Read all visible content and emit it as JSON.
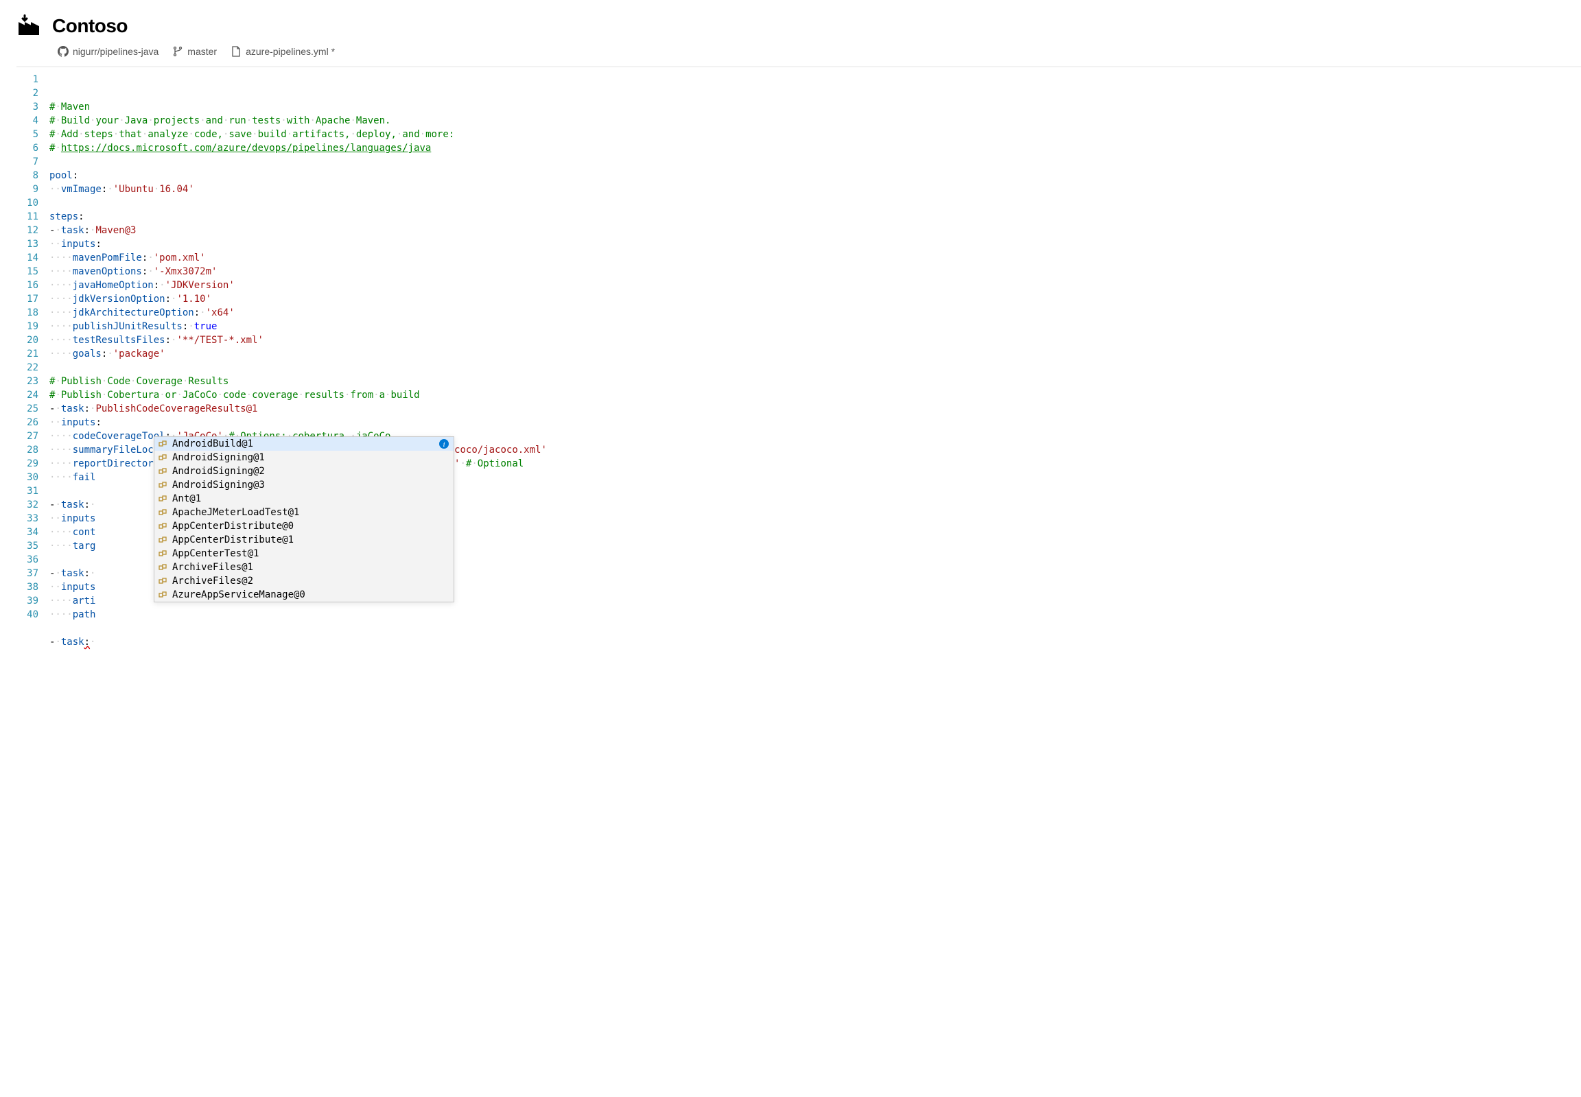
{
  "header": {
    "title": "Contoso"
  },
  "breadcrumb": {
    "repo": "nigurr/pipelines-java",
    "branch": "master",
    "file": "azure-pipelines.yml *"
  },
  "code": {
    "lines": [
      {
        "num": 1,
        "tokens": [
          {
            "t": "# ",
            "c": "comment"
          },
          {
            "t": "·",
            "c": "dot"
          },
          {
            "t": "Maven",
            "c": "comment"
          }
        ]
      },
      {
        "num": 2,
        "tokens": [
          {
            "t": "# ",
            "c": "comment"
          },
          {
            "t": "·",
            "c": "dot"
          },
          {
            "t": "Build",
            "c": "comment"
          },
          {
            "t": "·",
            "c": "dot"
          },
          {
            "t": "your",
            "c": "comment"
          },
          {
            "t": "·",
            "c": "dot"
          },
          {
            "t": "Java",
            "c": "comment"
          },
          {
            "t": "·",
            "c": "dot"
          },
          {
            "t": "projects",
            "c": "comment"
          },
          {
            "t": "·",
            "c": "dot"
          },
          {
            "t": "and",
            "c": "comment"
          },
          {
            "t": "·",
            "c": "dot"
          },
          {
            "t": "run",
            "c": "comment"
          },
          {
            "t": "·",
            "c": "dot"
          },
          {
            "t": "tests",
            "c": "comment"
          },
          {
            "t": "·",
            "c": "dot"
          },
          {
            "t": "with",
            "c": "comment"
          },
          {
            "t": "·",
            "c": "dot"
          },
          {
            "t": "Apache",
            "c": "comment"
          },
          {
            "t": "·",
            "c": "dot"
          },
          {
            "t": "Maven.",
            "c": "comment"
          }
        ]
      },
      {
        "num": 3,
        "tokens": [
          {
            "t": "# ",
            "c": "comment"
          },
          {
            "t": "·",
            "c": "dot"
          },
          {
            "t": "Add",
            "c": "comment"
          },
          {
            "t": "·",
            "c": "dot"
          },
          {
            "t": "steps",
            "c": "comment"
          },
          {
            "t": "·",
            "c": "dot"
          },
          {
            "t": "that",
            "c": "comment"
          },
          {
            "t": "·",
            "c": "dot"
          },
          {
            "t": "analyze",
            "c": "comment"
          },
          {
            "t": "·",
            "c": "dot"
          },
          {
            "t": "code,",
            "c": "comment"
          },
          {
            "t": "·",
            "c": "dot"
          },
          {
            "t": "save",
            "c": "comment"
          },
          {
            "t": "·",
            "c": "dot"
          },
          {
            "t": "build",
            "c": "comment"
          },
          {
            "t": "·",
            "c": "dot"
          },
          {
            "t": "artifacts,",
            "c": "comment"
          },
          {
            "t": "·",
            "c": "dot"
          },
          {
            "t": "deploy,",
            "c": "comment"
          },
          {
            "t": "·",
            "c": "dot"
          },
          {
            "t": "and",
            "c": "comment"
          },
          {
            "t": "·",
            "c": "dot"
          },
          {
            "t": "more:",
            "c": "comment"
          }
        ]
      },
      {
        "num": 4,
        "tokens": [
          {
            "t": "# ",
            "c": "comment"
          },
          {
            "t": "·",
            "c": "dot"
          },
          {
            "t": "https://docs.microsoft.com/azure/devops/pipelines/languages/java",
            "c": "comment underline"
          }
        ]
      },
      {
        "num": 5,
        "tokens": []
      },
      {
        "num": 6,
        "tokens": [
          {
            "t": "pool",
            "c": "key"
          },
          {
            "t": ":",
            "c": "punct"
          }
        ]
      },
      {
        "num": 7,
        "tokens": [
          {
            "t": "··",
            "c": "dot"
          },
          {
            "t": "vmImage",
            "c": "key"
          },
          {
            "t": ":",
            "c": "punct"
          },
          {
            "t": "·",
            "c": "dot"
          },
          {
            "t": "'Ubuntu",
            "c": "string"
          },
          {
            "t": "·",
            "c": "dot"
          },
          {
            "t": "16.04'",
            "c": "string"
          }
        ]
      },
      {
        "num": 8,
        "tokens": []
      },
      {
        "num": 9,
        "tokens": [
          {
            "t": "steps",
            "c": "key"
          },
          {
            "t": ":",
            "c": "punct"
          }
        ]
      },
      {
        "num": 10,
        "tokens": [
          {
            "t": "-",
            "c": "punct"
          },
          {
            "t": "·",
            "c": "dot"
          },
          {
            "t": "task",
            "c": "key"
          },
          {
            "t": ":",
            "c": "punct"
          },
          {
            "t": "·",
            "c": "dot"
          },
          {
            "t": "Maven@3",
            "c": "string"
          }
        ]
      },
      {
        "num": 11,
        "tokens": [
          {
            "t": "··",
            "c": "dot"
          },
          {
            "t": "inputs",
            "c": "key"
          },
          {
            "t": ":",
            "c": "punct"
          }
        ]
      },
      {
        "num": 12,
        "tokens": [
          {
            "t": "····",
            "c": "dot"
          },
          {
            "t": "mavenPomFile",
            "c": "key"
          },
          {
            "t": ":",
            "c": "punct"
          },
          {
            "t": "·",
            "c": "dot"
          },
          {
            "t": "'pom.xml'",
            "c": "string"
          }
        ]
      },
      {
        "num": 13,
        "tokens": [
          {
            "t": "····",
            "c": "dot"
          },
          {
            "t": "mavenOptions",
            "c": "key"
          },
          {
            "t": ":",
            "c": "punct"
          },
          {
            "t": "·",
            "c": "dot"
          },
          {
            "t": "'-Xmx3072m'",
            "c": "string"
          }
        ]
      },
      {
        "num": 14,
        "tokens": [
          {
            "t": "····",
            "c": "dot"
          },
          {
            "t": "javaHomeOption",
            "c": "key"
          },
          {
            "t": ":",
            "c": "punct"
          },
          {
            "t": "·",
            "c": "dot"
          },
          {
            "t": "'JDKVersion'",
            "c": "string"
          }
        ]
      },
      {
        "num": 15,
        "tokens": [
          {
            "t": "····",
            "c": "dot"
          },
          {
            "t": "jdkVersionOption",
            "c": "key"
          },
          {
            "t": ":",
            "c": "punct"
          },
          {
            "t": "·",
            "c": "dot"
          },
          {
            "t": "'1.10'",
            "c": "string"
          }
        ]
      },
      {
        "num": 16,
        "tokens": [
          {
            "t": "····",
            "c": "dot"
          },
          {
            "t": "jdkArchitectureOption",
            "c": "key"
          },
          {
            "t": ":",
            "c": "punct"
          },
          {
            "t": "·",
            "c": "dot"
          },
          {
            "t": "'x64'",
            "c": "string"
          }
        ]
      },
      {
        "num": 17,
        "tokens": [
          {
            "t": "····",
            "c": "dot"
          },
          {
            "t": "publishJUnitResults",
            "c": "key"
          },
          {
            "t": ":",
            "c": "punct"
          },
          {
            "t": "·",
            "c": "dot"
          },
          {
            "t": "true",
            "c": "bool"
          }
        ]
      },
      {
        "num": 18,
        "tokens": [
          {
            "t": "····",
            "c": "dot"
          },
          {
            "t": "testResultsFiles",
            "c": "key"
          },
          {
            "t": ":",
            "c": "punct"
          },
          {
            "t": "·",
            "c": "dot"
          },
          {
            "t": "'**/TEST-*.xml'",
            "c": "string"
          }
        ]
      },
      {
        "num": 19,
        "tokens": [
          {
            "t": "····",
            "c": "dot"
          },
          {
            "t": "goals",
            "c": "key"
          },
          {
            "t": ":",
            "c": "punct"
          },
          {
            "t": "·",
            "c": "dot"
          },
          {
            "t": "'package'",
            "c": "string"
          }
        ]
      },
      {
        "num": 20,
        "tokens": []
      },
      {
        "num": 21,
        "tokens": [
          {
            "t": "# ",
            "c": "comment"
          },
          {
            "t": "·",
            "c": "dot"
          },
          {
            "t": "Publish",
            "c": "comment"
          },
          {
            "t": "·",
            "c": "dot"
          },
          {
            "t": "Code",
            "c": "comment"
          },
          {
            "t": "·",
            "c": "dot"
          },
          {
            "t": "Coverage",
            "c": "comment"
          },
          {
            "t": "·",
            "c": "dot"
          },
          {
            "t": "Results",
            "c": "comment"
          }
        ]
      },
      {
        "num": 22,
        "tokens": [
          {
            "t": "# ",
            "c": "comment"
          },
          {
            "t": "·",
            "c": "dot"
          },
          {
            "t": "Publish",
            "c": "comment"
          },
          {
            "t": "·",
            "c": "dot"
          },
          {
            "t": "Cobertura",
            "c": "comment"
          },
          {
            "t": "·",
            "c": "dot"
          },
          {
            "t": "or",
            "c": "comment"
          },
          {
            "t": "·",
            "c": "dot"
          },
          {
            "t": "JaCoCo",
            "c": "comment"
          },
          {
            "t": "·",
            "c": "dot"
          },
          {
            "t": "code",
            "c": "comment"
          },
          {
            "t": "·",
            "c": "dot"
          },
          {
            "t": "coverage",
            "c": "comment"
          },
          {
            "t": "·",
            "c": "dot"
          },
          {
            "t": "results",
            "c": "comment"
          },
          {
            "t": "·",
            "c": "dot"
          },
          {
            "t": "from",
            "c": "comment"
          },
          {
            "t": "·",
            "c": "dot"
          },
          {
            "t": "a",
            "c": "comment"
          },
          {
            "t": "·",
            "c": "dot"
          },
          {
            "t": "build",
            "c": "comment"
          }
        ]
      },
      {
        "num": 23,
        "tokens": [
          {
            "t": "-",
            "c": "punct"
          },
          {
            "t": "·",
            "c": "dot"
          },
          {
            "t": "task",
            "c": "key"
          },
          {
            "t": ":",
            "c": "punct"
          },
          {
            "t": "·",
            "c": "dot"
          },
          {
            "t": "PublishCodeCoverageResults@1",
            "c": "string"
          }
        ]
      },
      {
        "num": 24,
        "tokens": [
          {
            "t": "··",
            "c": "dot"
          },
          {
            "t": "inputs",
            "c": "key"
          },
          {
            "t": ":",
            "c": "punct"
          }
        ]
      },
      {
        "num": 25,
        "tokens": [
          {
            "t": "····",
            "c": "dot"
          },
          {
            "t": "codeCoverageTool",
            "c": "key"
          },
          {
            "t": ":",
            "c": "punct"
          },
          {
            "t": "·",
            "c": "dot"
          },
          {
            "t": "'JaCoCo'",
            "c": "string"
          },
          {
            "t": "·",
            "c": "dot"
          },
          {
            "t": "# ",
            "c": "comment"
          },
          {
            "t": "·",
            "c": "dot"
          },
          {
            "t": "Options:",
            "c": "comment"
          },
          {
            "t": "·",
            "c": "dot"
          },
          {
            "t": "cobertura,",
            "c": "comment"
          },
          {
            "t": "·",
            "c": "dot"
          },
          {
            "t": "jaCoCo",
            "c": "comment"
          }
        ]
      },
      {
        "num": 26,
        "tokens": [
          {
            "t": "····",
            "c": "dot"
          },
          {
            "t": "summaryFileLocation",
            "c": "key"
          },
          {
            "t": ":",
            "c": "punct"
          },
          {
            "t": "·",
            "c": "dot"
          },
          {
            "t": "'$(System.DefaultWorkingDirectory)/**/site/jacoco/jacoco.xml'",
            "c": "string"
          }
        ]
      },
      {
        "num": 27,
        "tokens": [
          {
            "t": "····",
            "c": "dot"
          },
          {
            "t": "reportDirectory",
            "c": "key"
          },
          {
            "t": ":",
            "c": "punct"
          },
          {
            "t": "·",
            "c": "dot"
          },
          {
            "t": "'$(System.DefaultWorkingDirectory)/**/site/jacoco'",
            "c": "string"
          },
          {
            "t": "·",
            "c": "dot"
          },
          {
            "t": "# ",
            "c": "comment"
          },
          {
            "t": "·",
            "c": "dot"
          },
          {
            "t": "Optional",
            "c": "comment"
          }
        ]
      },
      {
        "num": 28,
        "tokens": [
          {
            "t": "····",
            "c": "dot"
          },
          {
            "t": "fail",
            "c": "key"
          }
        ]
      },
      {
        "num": 29,
        "tokens": []
      },
      {
        "num": 30,
        "tokens": [
          {
            "t": "-",
            "c": "punct"
          },
          {
            "t": "·",
            "c": "dot"
          },
          {
            "t": "task",
            "c": "key"
          },
          {
            "t": ":",
            "c": "punct"
          },
          {
            "t": "·",
            "c": "dot"
          }
        ]
      },
      {
        "num": 31,
        "tokens": [
          {
            "t": "··",
            "c": "dot"
          },
          {
            "t": "inputs",
            "c": "key"
          }
        ]
      },
      {
        "num": 32,
        "tokens": [
          {
            "t": "····",
            "c": "dot"
          },
          {
            "t": "cont",
            "c": "key"
          }
        ]
      },
      {
        "num": 33,
        "tokens": [
          {
            "t": "····",
            "c": "dot"
          },
          {
            "t": "targ",
            "c": "key"
          }
        ]
      },
      {
        "num": 34,
        "tokens": []
      },
      {
        "num": 35,
        "tokens": [
          {
            "t": "-",
            "c": "punct"
          },
          {
            "t": "·",
            "c": "dot"
          },
          {
            "t": "task",
            "c": "key"
          },
          {
            "t": ":",
            "c": "punct"
          },
          {
            "t": "·",
            "c": "dot"
          }
        ]
      },
      {
        "num": 36,
        "tokens": [
          {
            "t": "··",
            "c": "dot"
          },
          {
            "t": "inputs",
            "c": "key"
          }
        ]
      },
      {
        "num": 37,
        "tokens": [
          {
            "t": "····",
            "c": "dot"
          },
          {
            "t": "arti",
            "c": "key"
          }
        ]
      },
      {
        "num": 38,
        "tokens": [
          {
            "t": "····",
            "c": "dot"
          },
          {
            "t": "path",
            "c": "key"
          }
        ]
      },
      {
        "num": 39,
        "tokens": []
      },
      {
        "num": 40,
        "tokens": [
          {
            "t": "-",
            "c": "punct"
          },
          {
            "t": "·",
            "c": "dot"
          },
          {
            "t": "task",
            "c": "key"
          },
          {
            "t": ":",
            "c": "punct squiggle"
          },
          {
            "t": "·",
            "c": "dot"
          }
        ]
      }
    ]
  },
  "autocomplete": {
    "items": [
      {
        "label": "AndroidBuild@1",
        "selected": true
      },
      {
        "label": "AndroidSigning@1",
        "selected": false
      },
      {
        "label": "AndroidSigning@2",
        "selected": false
      },
      {
        "label": "AndroidSigning@3",
        "selected": false
      },
      {
        "label": "Ant@1",
        "selected": false
      },
      {
        "label": "ApacheJMeterLoadTest@1",
        "selected": false
      },
      {
        "label": "AppCenterDistribute@0",
        "selected": false
      },
      {
        "label": "AppCenterDistribute@1",
        "selected": false
      },
      {
        "label": "AppCenterTest@1",
        "selected": false
      },
      {
        "label": "ArchiveFiles@1",
        "selected": false
      },
      {
        "label": "ArchiveFiles@2",
        "selected": false
      },
      {
        "label": "AzureAppServiceManage@0",
        "selected": false
      }
    ]
  }
}
